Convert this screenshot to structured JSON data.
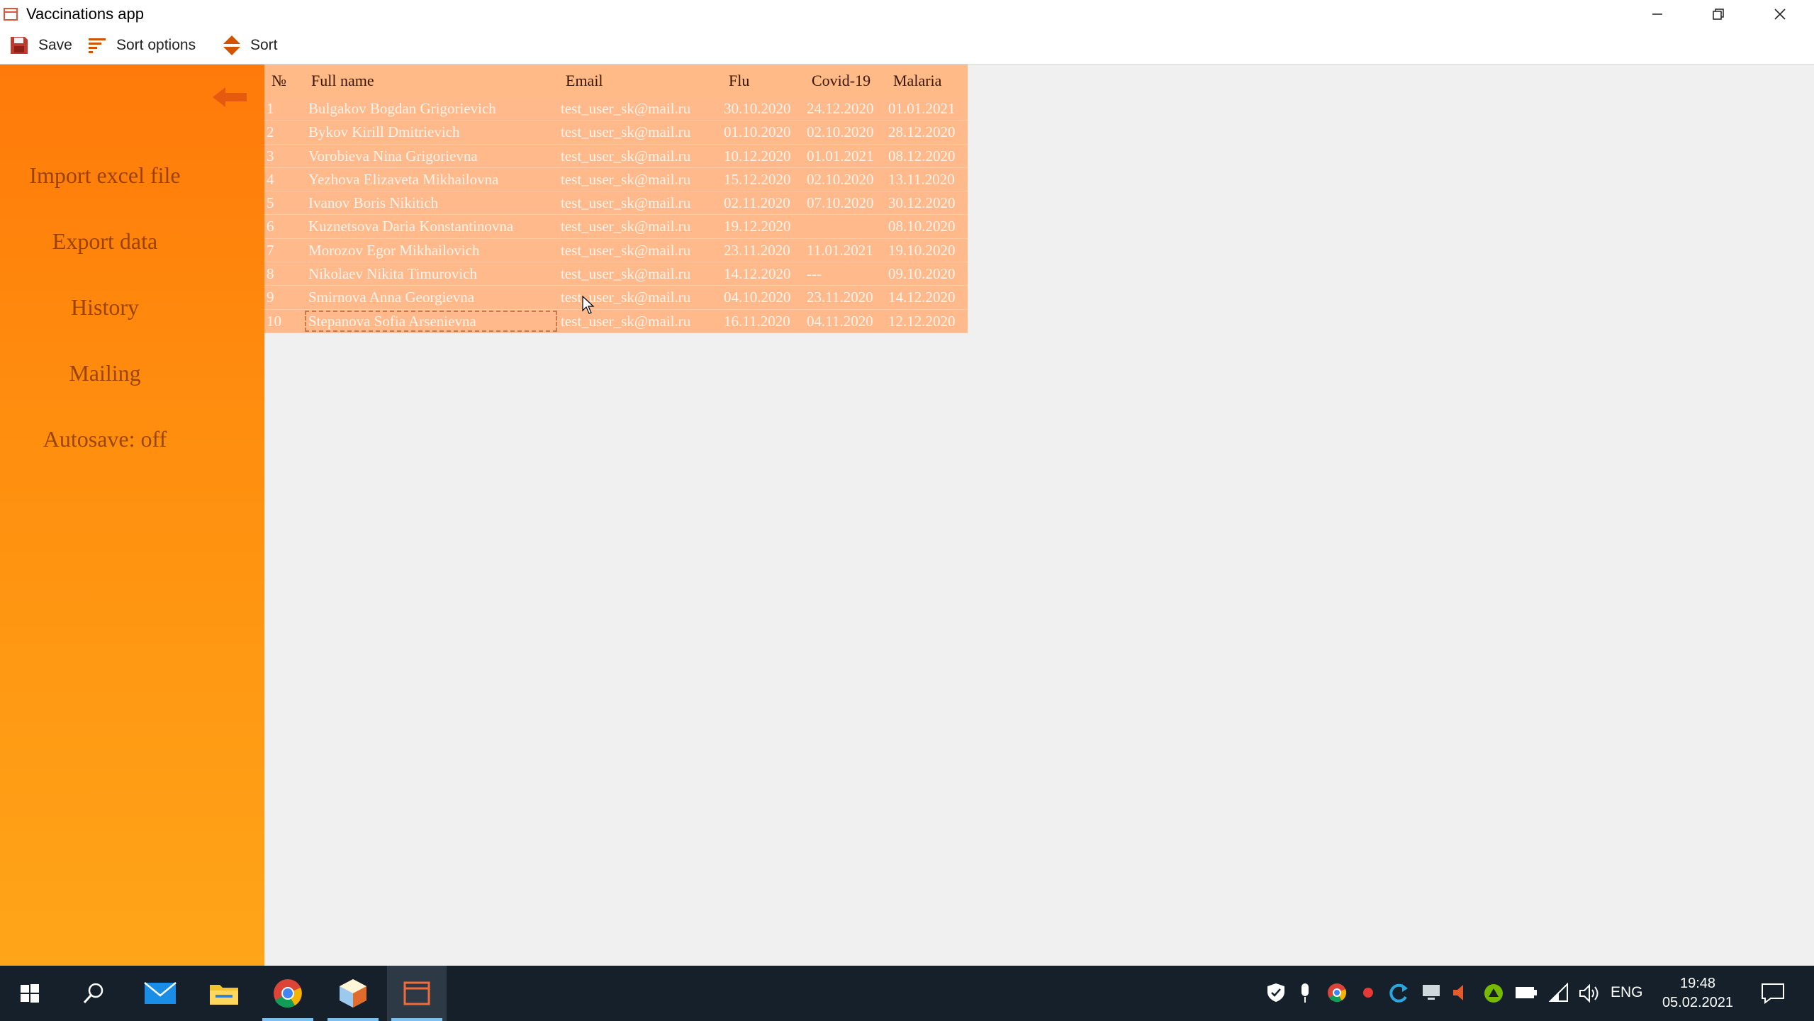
{
  "window": {
    "title": "Vaccinations app"
  },
  "toolbar": {
    "save_label": "Save",
    "sort_options_label": "Sort options",
    "sort_label": "Sort"
  },
  "sidebar": {
    "items": [
      {
        "label": "Import excel file"
      },
      {
        "label": "Export data"
      },
      {
        "label": "History"
      },
      {
        "label": "Mailing"
      },
      {
        "label": "Autosave: off"
      }
    ]
  },
  "table": {
    "columns": [
      "№",
      "Full name",
      "Email",
      "Flu",
      "Covid-19",
      "Malaria"
    ],
    "rows": [
      {
        "num": "1",
        "name": "Bulgakov Bogdan Grigorievich",
        "email": "test_user_sk@mail.ru",
        "flu": "30.10.2020",
        "covid": "24.12.2020",
        "malaria": "01.01.2021"
      },
      {
        "num": "2",
        "name": "Bykov Kirill Dmitrievich",
        "email": "test_user_sk@mail.ru",
        "flu": "01.10.2020",
        "covid": "02.10.2020",
        "malaria": "28.12.2020"
      },
      {
        "num": "3",
        "name": "Vorobieva Nina Grigorievna",
        "email": "test_user_sk@mail.ru",
        "flu": "10.12.2020",
        "covid": "01.01.2021",
        "malaria": "08.12.2020"
      },
      {
        "num": "4",
        "name": "Yezhova Elizaveta Mikhailovna",
        "email": "test_user_sk@mail.ru",
        "flu": "15.12.2020",
        "covid": "02.10.2020",
        "malaria": "13.11.2020"
      },
      {
        "num": "5",
        "name": "Ivanov Boris Nikitich",
        "email": "test_user_sk@mail.ru",
        "flu": "02.11.2020",
        "covid": "07.10.2020",
        "malaria": "30.12.2020"
      },
      {
        "num": "6",
        "name": "Kuznetsova Daria Konstantinovna",
        "email": "test_user_sk@mail.ru",
        "flu": "19.12.2020",
        "covid": "",
        "malaria": "08.10.2020"
      },
      {
        "num": "7",
        "name": "Morozov Egor Mikhailovich",
        "email": "test_user_sk@mail.ru",
        "flu": "23.11.2020",
        "covid": "11.01.2021",
        "malaria": "19.10.2020"
      },
      {
        "num": "8",
        "name": "Nikolaev Nikita Timurovich",
        "email": "test_user_sk@mail.ru",
        "flu": "14.12.2020",
        "covid": "---",
        "malaria": "09.10.2020"
      },
      {
        "num": "9",
        "name": "Smirnova Anna Georgievna",
        "email": "test_user_sk@mail.ru",
        "flu": "04.10.2020",
        "covid": "23.11.2020",
        "malaria": "14.12.2020"
      },
      {
        "num": "10",
        "name": "Stepanova Sofia Arsenievna",
        "email": "test_user_sk@mail.ru",
        "flu": "16.11.2020",
        "covid": "04.11.2020",
        "malaria": "12.12.2020"
      }
    ]
  },
  "taskbar": {
    "language": "ENG",
    "time": "19:48",
    "date": "05.02.2021",
    "apps": [
      "start-icon",
      "search-icon",
      "mail-icon",
      "file-explorer-icon",
      "chrome-icon",
      "cube-app-icon",
      "vaccinations-app-icon"
    ]
  },
  "colors": {
    "sidebar_top": "#ff7a0a",
    "sidebar_bottom": "#ffa519",
    "table_row": "#ffb98a",
    "taskbar": "#15202b"
  }
}
